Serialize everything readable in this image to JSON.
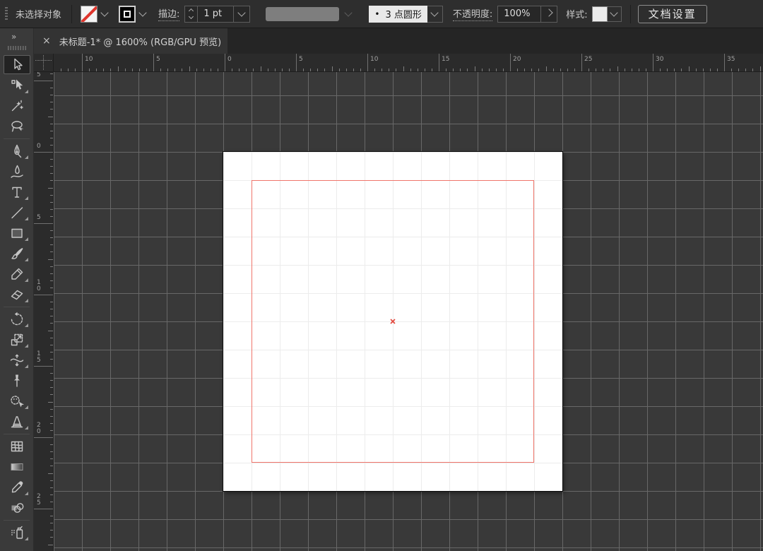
{
  "topBar": {
    "status": "未选择对象",
    "strokeLabel": "描边:",
    "strokeWeight": "1 pt",
    "brushBullet": "•",
    "brushName": "3 点圆形",
    "opacityLabel": "不透明度:",
    "opacityValue": "100%",
    "styleLabel": "样式:",
    "documentSetup": "文档设置"
  },
  "tabBar": {
    "closeGlyph": "×",
    "title": "未标题-1* @ 1600% (RGB/GPU 预览)"
  },
  "toolsPanel": {
    "expandGlyph": "»",
    "tools": [
      {
        "name": "selection-tool",
        "icon": "selection",
        "selected": true
      },
      {
        "name": "direct-selection-tool",
        "icon": "direct-selection",
        "flyout": true
      },
      {
        "name": "magic-wand-tool",
        "icon": "magic-wand"
      },
      {
        "name": "lasso-tool",
        "icon": "lasso"
      },
      {
        "type": "separator"
      },
      {
        "name": "pen-tool",
        "icon": "pen",
        "flyout": true
      },
      {
        "name": "curvature-tool",
        "icon": "curvature"
      },
      {
        "name": "type-tool",
        "icon": "type",
        "flyout": true
      },
      {
        "name": "line-segment-tool",
        "icon": "line",
        "flyout": true
      },
      {
        "name": "rectangle-tool",
        "icon": "rectangle",
        "flyout": true
      },
      {
        "name": "paintbrush-tool",
        "icon": "paintbrush",
        "flyout": true
      },
      {
        "name": "shaper-tool",
        "icon": "shaper",
        "flyout": true
      },
      {
        "name": "eraser-tool",
        "icon": "eraser",
        "flyout": true
      },
      {
        "type": "separator"
      },
      {
        "name": "rotate-tool",
        "icon": "rotate",
        "flyout": true
      },
      {
        "name": "scale-tool",
        "icon": "scale",
        "flyout": true
      },
      {
        "name": "width-tool",
        "icon": "width",
        "flyout": true
      },
      {
        "name": "puppet-warp-tool",
        "icon": "puppet-warp"
      },
      {
        "name": "shape-builder-tool",
        "icon": "shape-builder",
        "flyout": true
      },
      {
        "name": "perspective-grid-tool",
        "icon": "perspective-grid",
        "flyout": true
      },
      {
        "type": "separator"
      },
      {
        "name": "mesh-tool",
        "icon": "mesh"
      },
      {
        "name": "gradient-tool",
        "icon": "gradient"
      },
      {
        "name": "eyedropper-tool",
        "icon": "eyedropper",
        "flyout": true
      },
      {
        "name": "blend-tool",
        "icon": "blend"
      },
      {
        "type": "separator"
      },
      {
        "name": "symbol-sprayer-tool",
        "icon": "symbol-sprayer",
        "flyout": true
      }
    ]
  },
  "rulers": {
    "top": {
      "labels": [
        "10",
        "5",
        "0",
        "5",
        "10",
        "15",
        "20",
        "25",
        "30",
        "35"
      ]
    },
    "left": {
      "labels": [
        "5",
        "0",
        "5",
        "10",
        "15",
        "20",
        "25"
      ]
    }
  },
  "colors": {
    "noneFillRed": "#df352c",
    "artboardObjectStroke": "#f0756b",
    "canvasBackground": "#393939",
    "gridLine": "#686868"
  }
}
